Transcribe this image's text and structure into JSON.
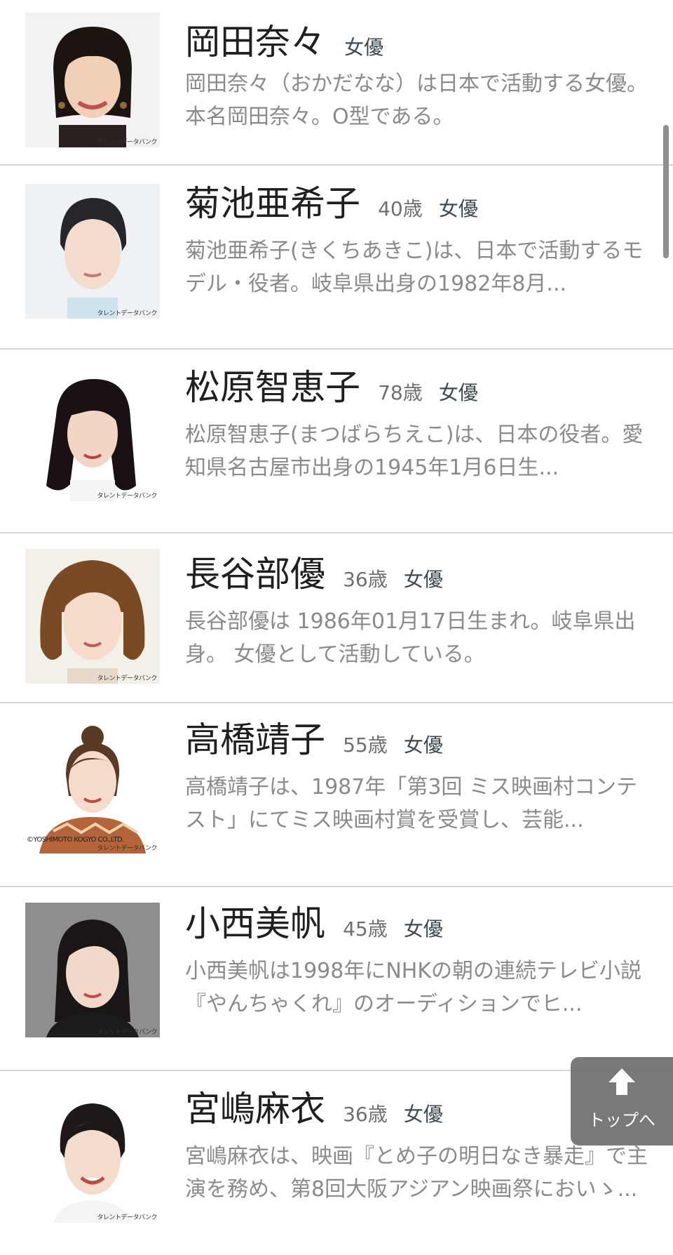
{
  "items": [
    {
      "name": "岡田奈々",
      "age": "",
      "job": "女優",
      "desc": "岡田奈々（おかだなな）は日本で活動する女優。本名岡田奈々。O型である。",
      "credit": "タレントデータバンク",
      "copyright": "",
      "photo_bg": "#f2f2f2",
      "hair": "#1b1410",
      "top_color": "#2a2020"
    },
    {
      "name": "菊池亜希子",
      "age": "40歳",
      "job": "女優",
      "desc": "菊池亜希子(きくちあきこ)は、日本で活動するモデル・役者。岐阜県出身の1982年8月...",
      "credit": "タレントデータバンク",
      "copyright": "",
      "photo_bg": "#eef2f4",
      "hair": "#24262c",
      "top_color": "#cfe3ee"
    },
    {
      "name": "松原智恵子",
      "age": "78歳",
      "job": "女優",
      "desc": "松原智恵子(まつばらちえこ)は、日本の役者。愛知県名古屋市出身の1945年1月6日生...",
      "credit": "タレントデータバンク",
      "copyright": "",
      "photo_bg": "#ffffff",
      "hair": "#1a1212",
      "top_color": "#f5f5f5"
    },
    {
      "name": "長谷部優",
      "age": "36歳",
      "job": "女優",
      "desc": "長谷部優は 1986年01月17日生まれ。岐阜県出身。 女優として活動している。",
      "credit": "タレントデータバンク",
      "copyright": "",
      "photo_bg": "#f3efe9",
      "hair": "#7a4a24",
      "top_color": "#e8d9c8"
    },
    {
      "name": "高橋靖子",
      "age": "55歳",
      "job": "女優",
      "desc": "高橋靖子は、1987年「第3回 ミス映画村コンテスト」にてミス映画村賞を受賞し、芸能...",
      "credit": "タレントデータバンク",
      "copyright": "©YOSHIMOTO KOGYO CO.,LTD.",
      "photo_bg": "#ffffff",
      "hair": "#5a3a24",
      "top_color": "#b5643a"
    },
    {
      "name": "小西美帆",
      "age": "45歳",
      "job": "女優",
      "desc": "小西美帆は1998年にNHKの朝の連続テレビ小説『やんちゃくれ』のオーディションでヒ...",
      "credit": "タレントデータバンク",
      "copyright": "",
      "photo_bg": "#8e8e8e",
      "hair": "#1a1616",
      "top_color": "#1c1c1c"
    },
    {
      "name": "宮嶋麻衣",
      "age": "36歳",
      "job": "女優",
      "desc": "宮嶋麻衣は、映画『とめ子の明日なき暴走』で主演を務め、第8回大阪アジアン映画祭においゝ...",
      "credit": "タレントデータバンク",
      "copyright": "",
      "photo_bg": "#ffffff",
      "hair": "#1e1818",
      "top_color": "#f4f4f4"
    }
  ],
  "top_button": {
    "label": "トップへ",
    "icon": "arrow-up-icon"
  },
  "colors": {
    "name": "#1f1f1f",
    "age": "#6f6f6f",
    "job": "#3c4a52",
    "desc": "#8a8a8a",
    "divider": "#d6d6d6"
  }
}
